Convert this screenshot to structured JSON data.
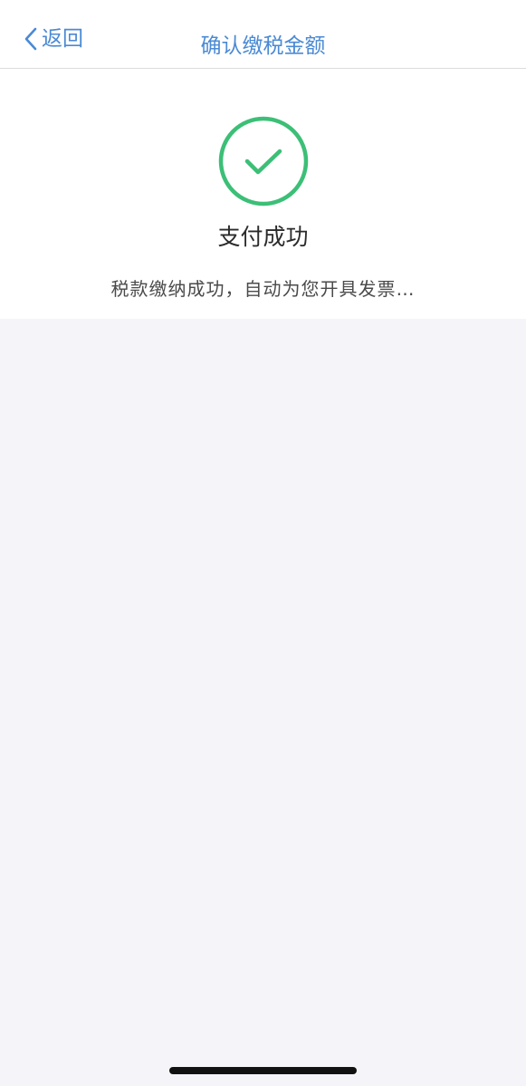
{
  "nav": {
    "back_label": "返回",
    "title": "确认缴税金额"
  },
  "result": {
    "icon": "check-circle-icon",
    "title": "支付成功",
    "message": "税款缴纳成功，自动为您开具发票…"
  },
  "colors": {
    "accent": "#4a8ad4",
    "success": "#3cbf77",
    "background": "#f4f4f9"
  }
}
